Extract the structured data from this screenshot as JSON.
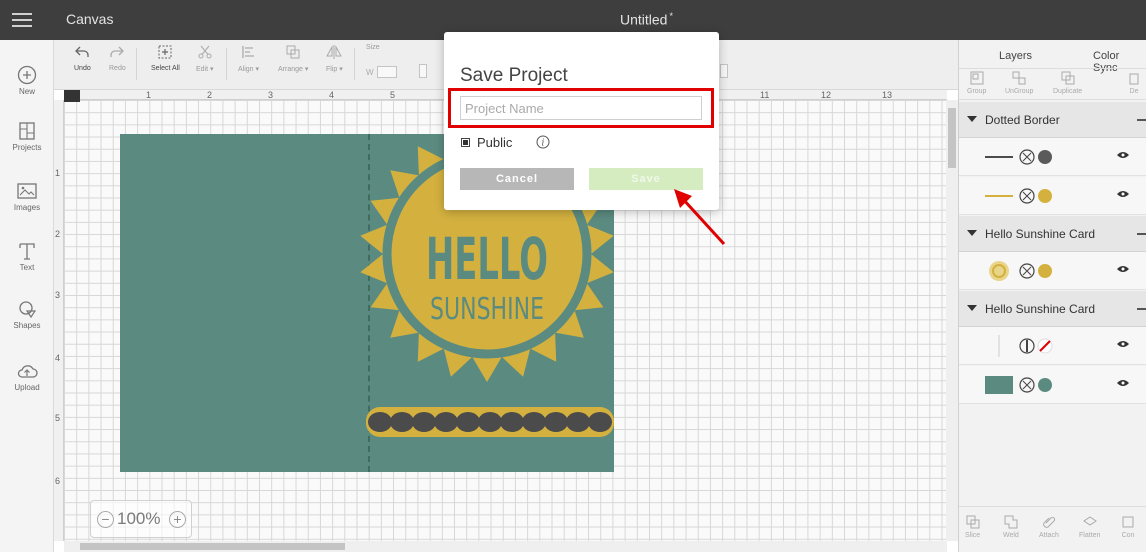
{
  "topbar": {
    "app_title": "Canvas",
    "doc_title": "Untitled",
    "unsaved_marker": "*"
  },
  "sidebar": {
    "items": [
      {
        "label": "New",
        "icon": "plus-circle-icon"
      },
      {
        "label": "Projects",
        "icon": "projects-icon"
      },
      {
        "label": "Images",
        "icon": "image-icon"
      },
      {
        "label": "Text",
        "icon": "text-icon"
      },
      {
        "label": "Shapes",
        "icon": "shapes-icon"
      },
      {
        "label": "Upload",
        "icon": "upload-cloud-icon"
      }
    ]
  },
  "toolbar": {
    "undo": "Undo",
    "redo": "Redo",
    "select_all": "Select All",
    "edit": "Edit ▾",
    "align": "Align ▾",
    "arrange": "Arrange ▾",
    "flip": "Flip ▾",
    "size": "Size",
    "w": "W"
  },
  "ruler": {
    "top": [
      "1",
      "2",
      "3",
      "4",
      "5",
      "11",
      "12",
      "13"
    ],
    "left": [
      "1",
      "2",
      "3",
      "4",
      "5",
      "6"
    ]
  },
  "zoom": {
    "level": "100%"
  },
  "design": {
    "line1": "HELLO",
    "line2": "SUNSHINE"
  },
  "layers_panel": {
    "tab_layers": "Layers",
    "tab_color_sync": "Color Sync",
    "tools": [
      "Group",
      "UnGroup",
      "Duplicate",
      "De"
    ],
    "bottom_tools": [
      "Slice",
      "Weld",
      "Attach",
      "Flatten",
      "Con"
    ],
    "groups": [
      {
        "name": "Dotted Border"
      },
      {
        "name": "Hello Sunshine Card"
      },
      {
        "name": "Hello Sunshine Card"
      }
    ]
  },
  "dialog": {
    "title": "Save Project",
    "name_value": "",
    "name_placeholder": "Project Name",
    "public_label": "Public",
    "public_checked": true,
    "cancel": "Cancel",
    "save": "Save"
  },
  "colors": {
    "topbar": "#3e3e3e",
    "card_teal": "#5b8b80",
    "sun_yellow": "#d4b13f",
    "scallop_dark": "#4b4b4b",
    "save_disabled": "#d5ecc0",
    "cancel_gray": "#b7b7b7",
    "annotation_red": "#e00000"
  }
}
